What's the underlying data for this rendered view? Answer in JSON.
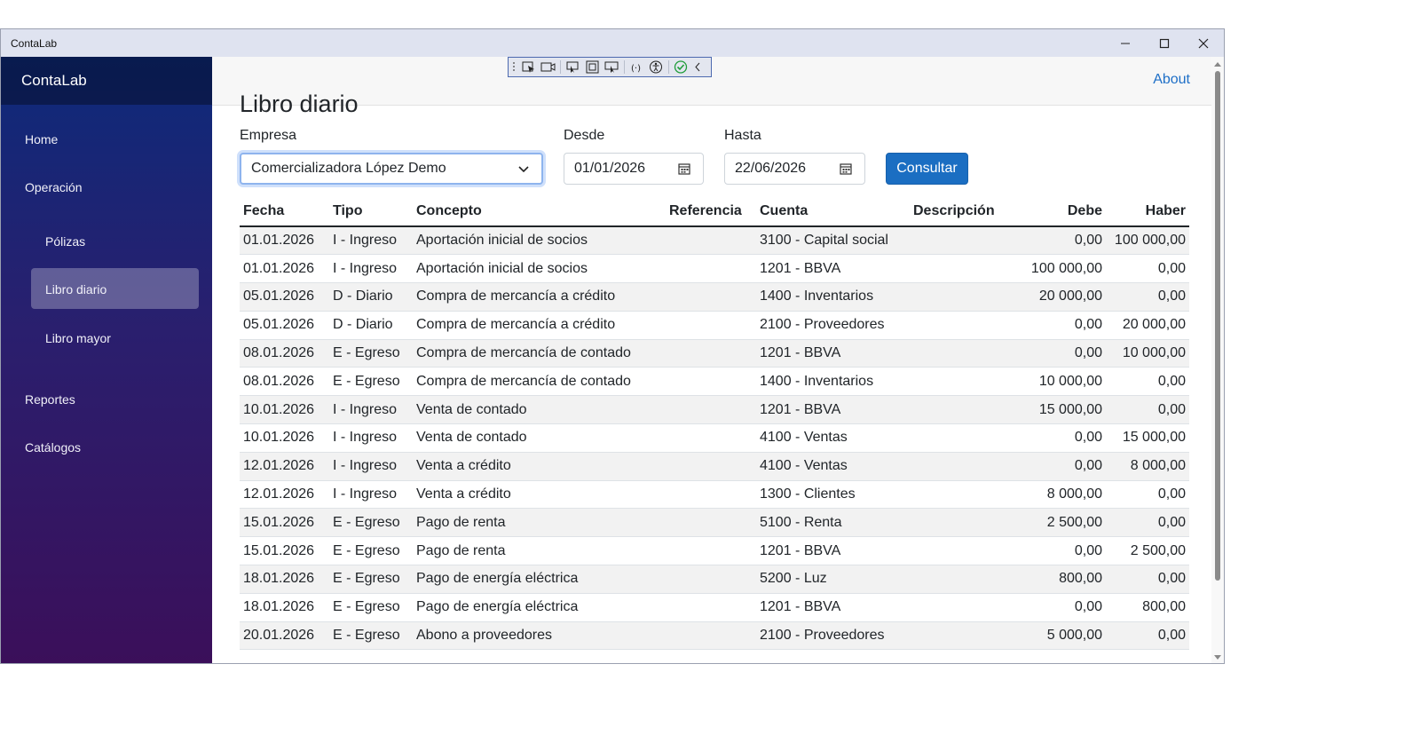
{
  "window": {
    "title": "ContaLab"
  },
  "sidebar": {
    "brand": "ContaLab",
    "items": [
      {
        "label": "Home"
      },
      {
        "label": "Operación"
      },
      {
        "label": "Pólizas"
      },
      {
        "label": "Libro diario"
      },
      {
        "label": "Libro mayor"
      },
      {
        "label": "Reportes"
      },
      {
        "label": "Catálogos"
      }
    ]
  },
  "topbar": {
    "about": "About"
  },
  "page": {
    "title": "Libro diario",
    "empresa_label": "Empresa",
    "empresa_value": "Comercializadora López Demo",
    "desde_label": "Desde",
    "desde_value": "01/01/2026",
    "hasta_label": "Hasta",
    "hasta_value": "22/06/2026",
    "consultar": "Consultar"
  },
  "table": {
    "headers": [
      "Fecha",
      "Tipo",
      "Concepto",
      "Referencia",
      "Cuenta",
      "Descripción",
      "Debe",
      "Haber"
    ],
    "rows": [
      [
        "01.01.2026",
        "I - Ingreso",
        "Aportación inicial de socios",
        "",
        "3100 - Capital social",
        "",
        "0,00",
        "100 000,00"
      ],
      [
        "01.01.2026",
        "I - Ingreso",
        "Aportación inicial de socios",
        "",
        "1201 - BBVA",
        "",
        "100 000,00",
        "0,00"
      ],
      [
        "05.01.2026",
        "D - Diario",
        "Compra de mercancía a crédito",
        "",
        "1400 - Inventarios",
        "",
        "20 000,00",
        "0,00"
      ],
      [
        "05.01.2026",
        "D - Diario",
        "Compra de mercancía a crédito",
        "",
        "2100 - Proveedores",
        "",
        "0,00",
        "20 000,00"
      ],
      [
        "08.01.2026",
        "E - Egreso",
        "Compra de mercancía de contado",
        "",
        "1201 - BBVA",
        "",
        "0,00",
        "10 000,00"
      ],
      [
        "08.01.2026",
        "E - Egreso",
        "Compra de mercancía de contado",
        "",
        "1400 - Inventarios",
        "",
        "10 000,00",
        "0,00"
      ],
      [
        "10.01.2026",
        "I - Ingreso",
        "Venta de contado",
        "",
        "1201 - BBVA",
        "",
        "15 000,00",
        "0,00"
      ],
      [
        "10.01.2026",
        "I - Ingreso",
        "Venta de contado",
        "",
        "4100 - Ventas",
        "",
        "0,00",
        "15 000,00"
      ],
      [
        "12.01.2026",
        "I - Ingreso",
        "Venta a crédito",
        "",
        "4100 - Ventas",
        "",
        "0,00",
        "8 000,00"
      ],
      [
        "12.01.2026",
        "I - Ingreso",
        "Venta a crédito",
        "",
        "1300 - Clientes",
        "",
        "8 000,00",
        "0,00"
      ],
      [
        "15.01.2026",
        "E - Egreso",
        "Pago de renta",
        "",
        "5100 - Renta",
        "",
        "2 500,00",
        "0,00"
      ],
      [
        "15.01.2026",
        "E - Egreso",
        "Pago de renta",
        "",
        "1201 - BBVA",
        "",
        "0,00",
        "2 500,00"
      ],
      [
        "18.01.2026",
        "E - Egreso",
        "Pago de energía eléctrica",
        "",
        "5200 - Luz",
        "",
        "800,00",
        "0,00"
      ],
      [
        "18.01.2026",
        "E - Egreso",
        "Pago de energía eléctrica",
        "",
        "1201 - BBVA",
        "",
        "0,00",
        "800,00"
      ],
      [
        "20.01.2026",
        "E - Egreso",
        "Abono a proveedores",
        "",
        "2100 - Proveedores",
        "",
        "5 000,00",
        "0,00"
      ]
    ]
  }
}
